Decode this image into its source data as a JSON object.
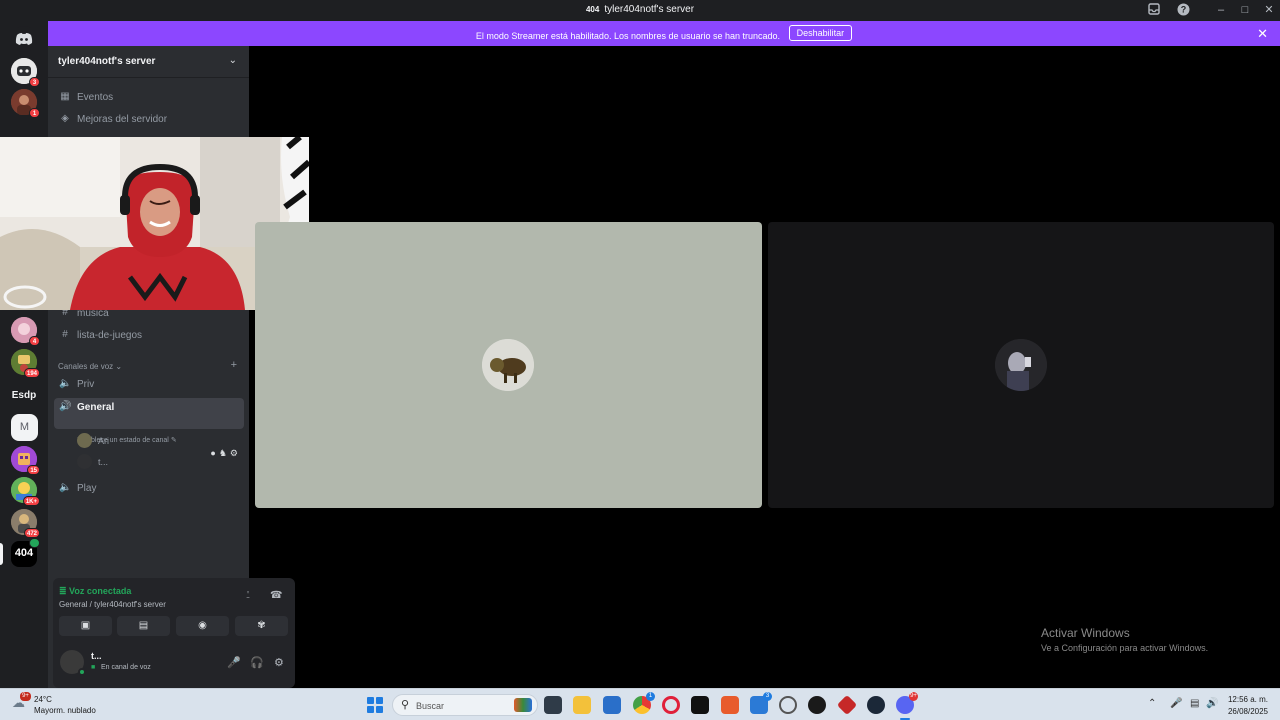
{
  "window": {
    "title": "tyler404notf's server",
    "server_badge": "404"
  },
  "banner": {
    "text": "El modo Streamer está habilitado. Los nombres de usuario se han truncado.",
    "button": "Deshabilitar"
  },
  "rail": {
    "badges": [
      "3",
      "1",
      "4",
      "194",
      "15",
      "1K+",
      "472"
    ],
    "text_items": [
      "Esdp",
      "M"
    ],
    "selected_label": "404"
  },
  "sidebar": {
    "server_name": "tyler404notf's server",
    "nav": [
      "Eventos",
      "Mejoras del servidor"
    ],
    "text_channels": [
      "música",
      "lista-de-juegos"
    ],
    "voice_category": "Canales de voz",
    "voice_channels": [
      {
        "name": "Priv"
      },
      {
        "name": "General",
        "status": "Establece un estado de canal",
        "members": [
          "Ari",
          "t..."
        ]
      },
      {
        "name": "Play"
      }
    ]
  },
  "voice_panel": {
    "status": "Voz conectada",
    "location": "General / tyler404notf's server",
    "user_name": "t...",
    "user_status": "En canal de voz"
  },
  "watermark": {
    "line1": "Activar Windows",
    "line2": "Ve a Configuración para activar Windows."
  },
  "taskbar": {
    "weather_temp": "24°C",
    "weather_cond": "Mayorm. nublado",
    "weather_badge": "9+",
    "search_placeholder": "Buscar",
    "badges": {
      "opera": "1",
      "store": "3",
      "discord": "9+"
    },
    "time": "12:56 a. m.",
    "date": "26/08/2025"
  },
  "colors": {
    "banner": "#8c47ff",
    "connected": "#23a55a",
    "sidebar": "#2b2d31",
    "rail": "#1e1f22"
  }
}
